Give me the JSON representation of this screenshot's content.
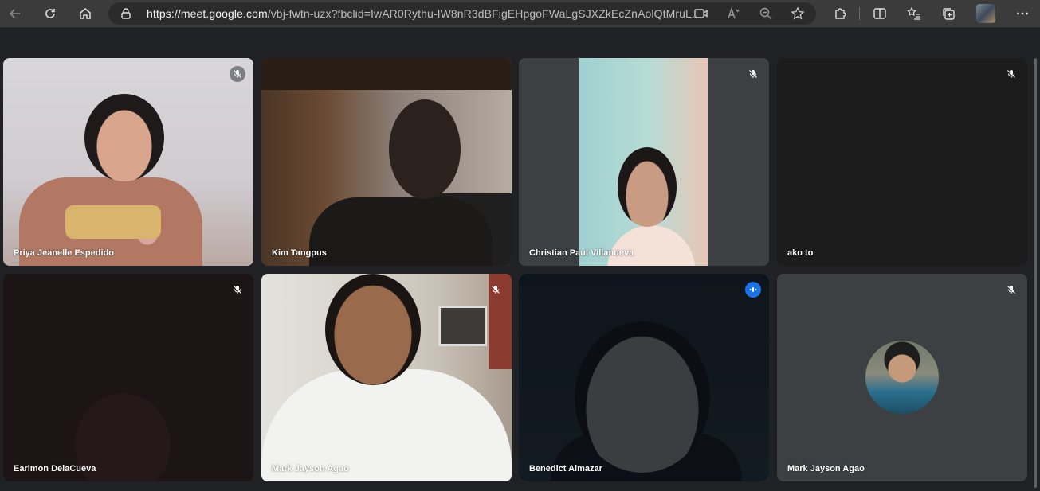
{
  "browser": {
    "url_domain": "https://meet.google.com",
    "url_path": "/vbj-fwtn-uzx?fbclid=IwAR0Rythu-IW8nR3dBFigEHpgoFWaLgSJXZkEcZnAolQtMruL...",
    "icons": {
      "back": "arrow-left-icon",
      "reload": "reload-icon",
      "home": "home-icon",
      "lock": "lock-icon",
      "camera": "camera-icon",
      "read_aloud": "read-aloud-icon",
      "zoom": "zoom-out-icon",
      "favorite": "star-icon",
      "extensions": "puzzle-icon",
      "split_screen": "split-screen-icon",
      "favorites": "favorites-list-icon",
      "collections": "collections-icon",
      "profile": "profile-avatar",
      "more": "more-dots-icon"
    }
  },
  "participants": [
    {
      "name": "Priya Jeanelle Espedido",
      "mic": "muted"
    },
    {
      "name": "Kim Tangpus",
      "mic": "none"
    },
    {
      "name": "Christian Paul Villanueva",
      "mic": "muted"
    },
    {
      "name": "ako to",
      "mic": "muted"
    },
    {
      "name": "Earlmon DelaCueva",
      "mic": "muted"
    },
    {
      "name": "Mark Jayson Agao",
      "mic": "muted"
    },
    {
      "name": "Benedict Almazar",
      "mic": "speaking"
    },
    {
      "name": "Mark Jayson Agao",
      "mic": "muted"
    }
  ],
  "colors": {
    "toolbar": "#3b3b3b",
    "meet_background": "#202124",
    "tile_background": "#3c4043",
    "speaking_accent": "#1a73e8",
    "active_border": "#8ab4f8"
  }
}
